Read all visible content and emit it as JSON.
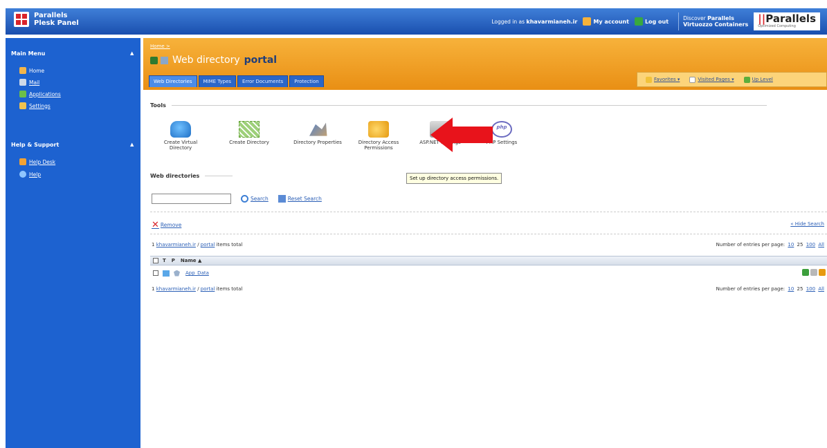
{
  "topbar": {
    "brand_line1": "Parallels",
    "brand_line2": "Plesk Panel",
    "logged_in_prefix": "Logged in as",
    "username": "khavarmianeh.ir",
    "my_account": "My account",
    "log_out": "Log out",
    "discover_prefix": "Discover",
    "discover_brand": "Parallels",
    "discover_product": "Virtuozzo Containers",
    "logo_text": "Parallels",
    "logo_tagline": "Optimized Computing"
  },
  "sidebar": {
    "main_menu": "Main Menu",
    "items": [
      {
        "label": "Home"
      },
      {
        "label": "Mail"
      },
      {
        "label": "Applications"
      },
      {
        "label": "Settings"
      }
    ],
    "help_support": "Help & Support",
    "help_items": [
      {
        "label": "Help Desk"
      },
      {
        "label": "Help"
      }
    ]
  },
  "header": {
    "breadcrumb": "Home >",
    "title_prefix": "Web directory",
    "title_name": "portal",
    "tabs": [
      {
        "label": "Web Directories"
      },
      {
        "label": "MIME Types"
      },
      {
        "label": "Error Documents"
      },
      {
        "label": "Protection"
      }
    ],
    "favorites": "Favorites",
    "visited_pages": "Visited Pages",
    "up_level": "Up Level"
  },
  "tools": {
    "heading": "Tools",
    "items": [
      {
        "line1": "Create Virtual",
        "line2": "Directory"
      },
      {
        "line1": "Create Directory",
        "line2": ""
      },
      {
        "line1": "Directory Properties",
        "line2": ""
      },
      {
        "line1": "Directory Access",
        "line2": "Permissions"
      },
      {
        "line1": "ASP.NET Settings",
        "line2": ""
      },
      {
        "line1": "PHP Settings",
        "line2": ""
      }
    ],
    "php_icon_text": "php",
    "tooltip": "Set up directory access permissions."
  },
  "webdirs": {
    "heading": "Web directories",
    "search_value": "",
    "search_label": "Search",
    "reset_label": "Reset Search",
    "remove_label": "Remove",
    "hide_search": "« Hide Search",
    "path_count": "1",
    "path_root": "khavarmianeh.ir",
    "path_sep": "/",
    "path_dir": "portal",
    "items_total": "items total",
    "per_page_label": "Number of entries per page:",
    "per_page_options": [
      "10",
      "25",
      "100",
      "All"
    ],
    "columns": {
      "t": "T",
      "p": "P",
      "name": "Name ▲"
    },
    "rows": [
      {
        "name": "App_Data"
      }
    ]
  }
}
